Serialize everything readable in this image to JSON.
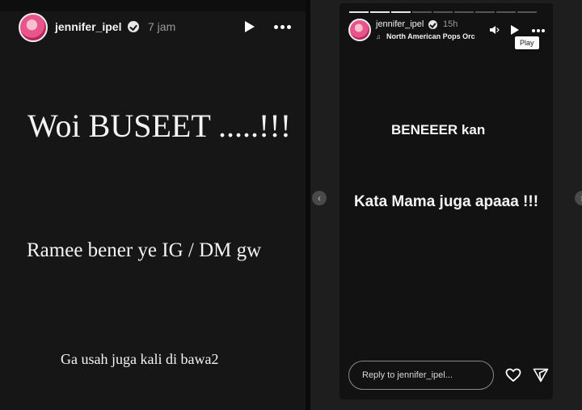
{
  "left_story": {
    "username": "jennifer_ipel",
    "time": "7 jam",
    "icons": [
      "verified-badge-icon",
      "play-icon",
      "more-options-icon"
    ],
    "lines": [
      "Woi BUSEET .....!!!",
      "Ramee bener ye IG / DM gw",
      "Ga usah juga kali di bawa2"
    ]
  },
  "right_story": {
    "username": "jennifer_ipel",
    "time": "15h",
    "music": "North American Pops Orc",
    "icons": [
      "verified-badge-icon",
      "sound-icon",
      "play-icon",
      "more-options-icon",
      "heart-icon",
      "send-icon",
      "prev-arrow-icon",
      "next-arrow-icon"
    ],
    "tooltip": "Play",
    "lines": [
      "BENEEER kan",
      "Kata Mama juga apaaa !!!"
    ],
    "reply_placeholder": "Reply to jennifer_ipel...",
    "progress_segments": 10,
    "progress_completed": 3
  }
}
